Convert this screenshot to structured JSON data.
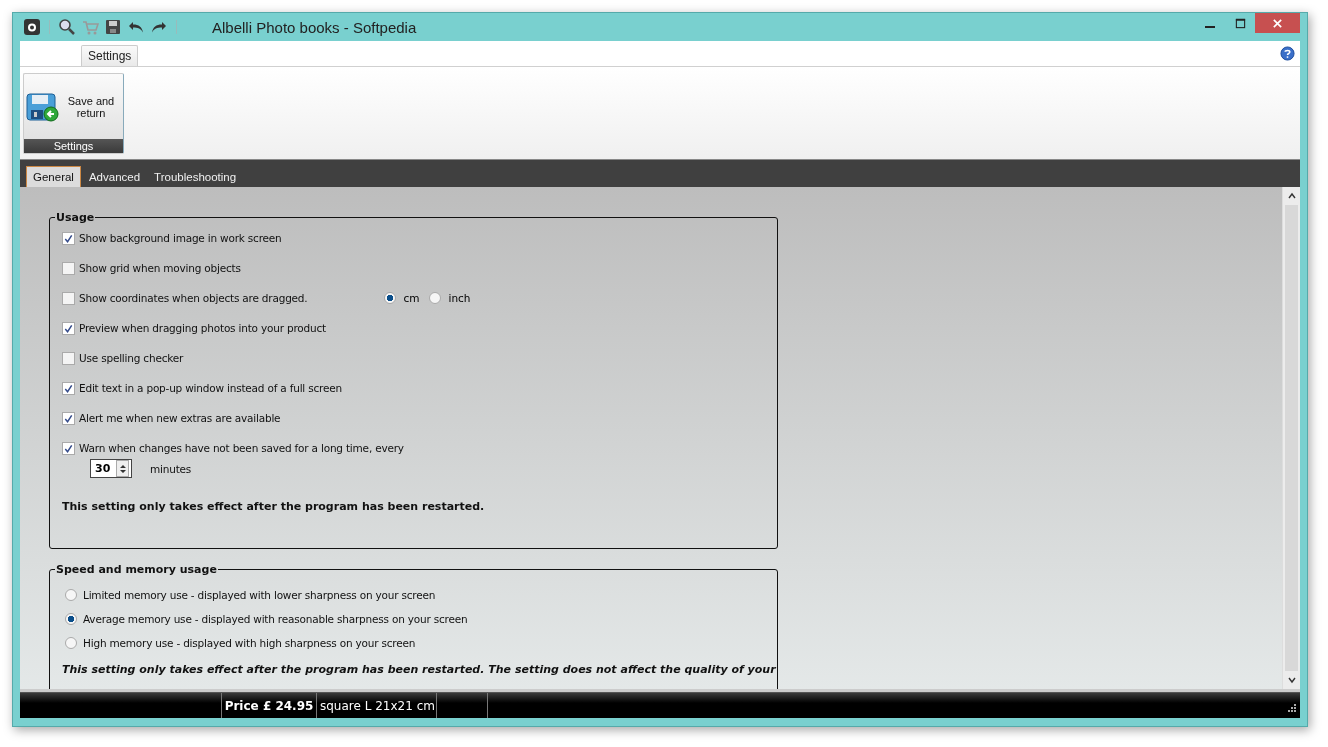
{
  "window": {
    "title": "Albelli Photo books - Softpedia"
  },
  "ribbon": {
    "tabs": [
      {
        "label": "Settings",
        "selected": true
      }
    ],
    "button": {
      "label": "Save and return"
    },
    "group_label": "Settings"
  },
  "tabs": [
    {
      "label": "General",
      "selected": true
    },
    {
      "label": "Advanced",
      "selected": false
    },
    {
      "label": "Troubleshooting",
      "selected": false
    }
  ],
  "usage": {
    "title": "Usage",
    "options": [
      {
        "label": "Show background image in work screen",
        "checked": true
      },
      {
        "label": "Show grid when moving objects",
        "checked": false
      },
      {
        "label": "Show coordinates when objects are dragged.",
        "checked": false,
        "units": [
          {
            "label": "cm",
            "selected": true
          },
          {
            "label": "inch",
            "selected": false
          }
        ]
      },
      {
        "label": "Preview when dragging photos into your product",
        "checked": true
      },
      {
        "label": "Use spelling checker",
        "checked": false
      },
      {
        "label": "Edit text in a pop-up window instead of a full screen",
        "checked": true
      },
      {
        "label": "Alert me when new extras are available",
        "checked": true
      },
      {
        "label": "Warn when changes have not been saved for a long time, every",
        "checked": true,
        "interval": {
          "value": "30",
          "unit": "minutes"
        }
      }
    ],
    "note": "This setting only takes effect after the program has been restarted."
  },
  "memory": {
    "title": "Speed and memory usage",
    "options": [
      {
        "label": "Limited memory use - displayed with lower sharpness on your screen",
        "selected": false
      },
      {
        "label": "Average memory use - displayed with reasonable sharpness on your screen",
        "selected": true
      },
      {
        "label": "High memory use - displayed with high sharpness on your screen",
        "selected": false
      }
    ],
    "note": "This setting only takes effect after the program has been restarted. The setting does not affect the quality of your"
  },
  "status_bar": {
    "price": "Price £ 24.95",
    "format": "square L 21x21 cm"
  }
}
